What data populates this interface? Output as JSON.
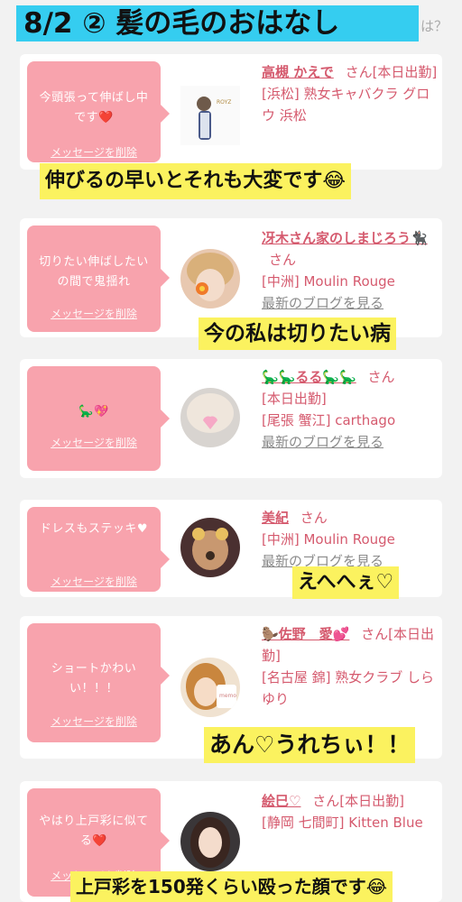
{
  "header": {
    "title": "8/2 ② 髪の毛のおはなし",
    "corner_text": "は？"
  },
  "cards": [
    {
      "message": "今頭張って伸ばし中です❤️",
      "delete_label": "メッセージを削除",
      "name": "高槻 かえで",
      "san": "さん",
      "line1": "[本日出勤]",
      "line2": "[浜松] 熟女キャバクラ グロウ 浜松",
      "caption": "伸びるの早いとそれも大変です😂"
    },
    {
      "message": "切りたい伸ばしたいの間で鬼揺れ",
      "delete_label": "メッセージを削除",
      "name": "冴木さん家のしまじろう🐈‍⬛",
      "san": "さん",
      "line2": "[中洲] Moulin Rouge",
      "blog": "最新のブログを見る",
      "caption": "今の私は切りたい病"
    },
    {
      "message": "🦕💖",
      "delete_label": "メッセージを削除",
      "name": "🦕🦕るる🦕🦕",
      "san": "さん",
      "line1": "[本日出勤]",
      "line2": "[尾張 蟹江] carthago",
      "blog": "最新のブログを見る",
      "caption": ""
    },
    {
      "message": "ドレスもステッキ♥",
      "delete_label": "メッセージを削除",
      "name": "美紀",
      "san": "さん",
      "line2": "[中洲] Moulin Rouge",
      "blog": "最新のブログを見る",
      "caption": "えへへぇ♡"
    },
    {
      "message": "ショートかわいい！！！",
      "delete_label": "メッセージを削除",
      "name": "🦫佐野　愛💕",
      "san": "さん",
      "line1": "[本日出勤]",
      "line2": "[名古屋 錦] 熟女クラブ しらゆり",
      "caption": "あん♡うれちぃ！！"
    },
    {
      "message": "やはり上戸彩に似てる❤️",
      "delete_label": "メッセージを削除",
      "name": "絵巳♡",
      "san": "さん",
      "line1": "[本日出勤]",
      "line2": "[静岡 七間町] Kitten Blue",
      "caption": "上戸彩を150発くらい殴った顔です😂"
    }
  ]
}
